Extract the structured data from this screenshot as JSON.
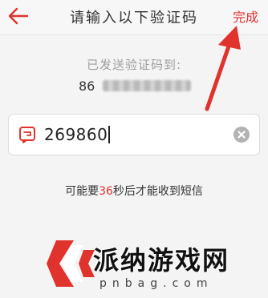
{
  "header": {
    "back_icon": "arrow-left-icon",
    "title": "请输入以下验证码",
    "done_label": "完成"
  },
  "info": {
    "sent_label": "已发送验证码到:",
    "phone_prefix": "86"
  },
  "code_input": {
    "leading_icon": "sms-icon",
    "value": "269860",
    "clear_icon": "clear-circle-icon"
  },
  "hint": {
    "prefix": "可能要",
    "seconds": "36",
    "suffix": "秒后才能收到短信"
  },
  "watermark": {
    "name": "派纳游戏网",
    "domain": "pnbag.com"
  },
  "colors": {
    "accent": "#e0332e",
    "background": "#f4f4f4",
    "text": "#333333",
    "muted": "#9e9e9e"
  }
}
